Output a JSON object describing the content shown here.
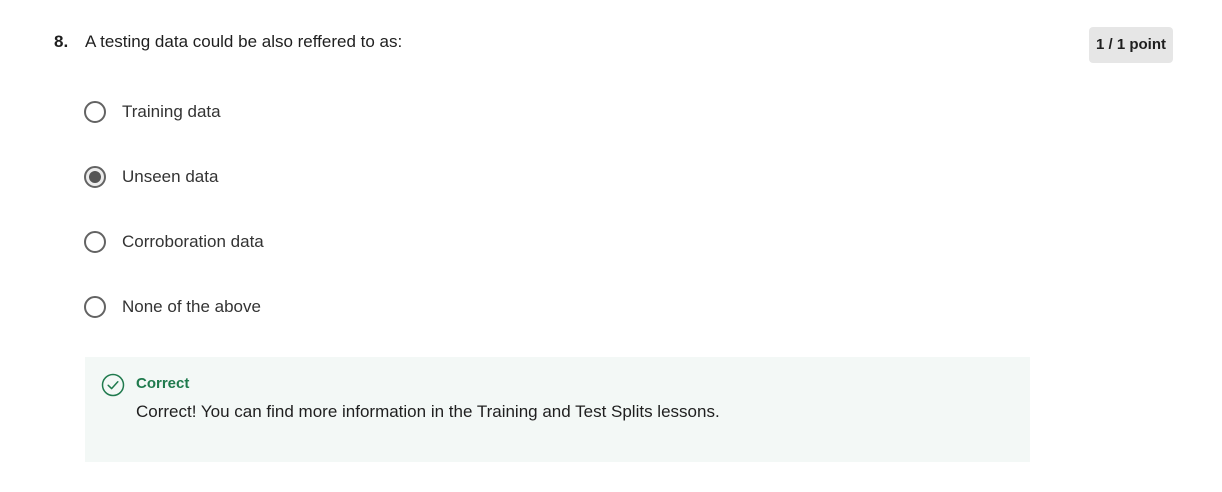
{
  "question": {
    "number": "8.",
    "text": "A testing data could be also reffered to as:",
    "points": "1 / 1 point"
  },
  "options": [
    {
      "label": "Training data",
      "selected": false
    },
    {
      "label": "Unseen data",
      "selected": true
    },
    {
      "label": "Corroboration data",
      "selected": false
    },
    {
      "label": "None of the above",
      "selected": false
    }
  ],
  "feedback": {
    "status": "Correct",
    "message": "Correct! You can find more information in the Training and Test Splits lessons.",
    "icon": "check-circle-icon"
  },
  "colors": {
    "correct_green": "#1f7a4d",
    "feedback_bg": "#f3f8f6",
    "badge_bg": "#e6e6e6",
    "radio_border": "#636363"
  }
}
